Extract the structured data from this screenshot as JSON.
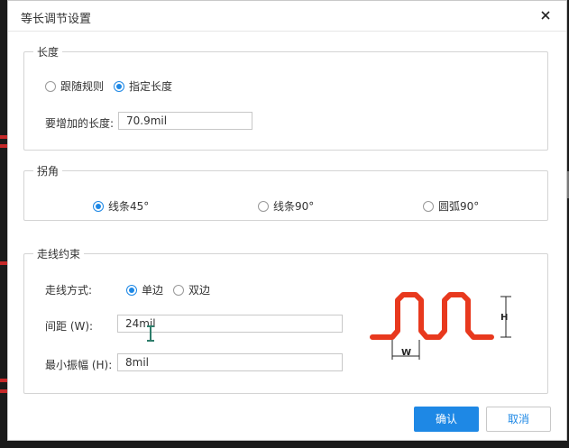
{
  "dialog": {
    "title": "等长调节设置",
    "close_icon": "close-icon"
  },
  "length_group": {
    "legend": "长度",
    "options": [
      {
        "label": "跟随规则",
        "selected": false
      },
      {
        "label": "指定长度",
        "selected": true
      }
    ],
    "increase_label": "要增加的长度:",
    "increase_value": "70.9mil"
  },
  "corner_group": {
    "legend": "拐角",
    "options": [
      {
        "label": "线条45°",
        "selected": true
      },
      {
        "label": "线条90°",
        "selected": false
      },
      {
        "label": "圆弧90°",
        "selected": false
      }
    ]
  },
  "routing_group": {
    "legend": "走线约束",
    "mode_label": "走线方式:",
    "mode_options": [
      {
        "label": "单边",
        "selected": true
      },
      {
        "label": "双边",
        "selected": false
      }
    ],
    "spacing_label": "间距 (W):",
    "spacing_value": "24mil",
    "amplitude_label": "最小振幅 (H):",
    "amplitude_value": "8mil",
    "diagram_w_label": "W",
    "diagram_h_label": "H",
    "trace_color": "#e8391e"
  },
  "footer": {
    "ok_label": "确认",
    "cancel_label": "取消"
  },
  "colors": {
    "accent": "#1e88e5",
    "background": "#1a1a1a"
  }
}
